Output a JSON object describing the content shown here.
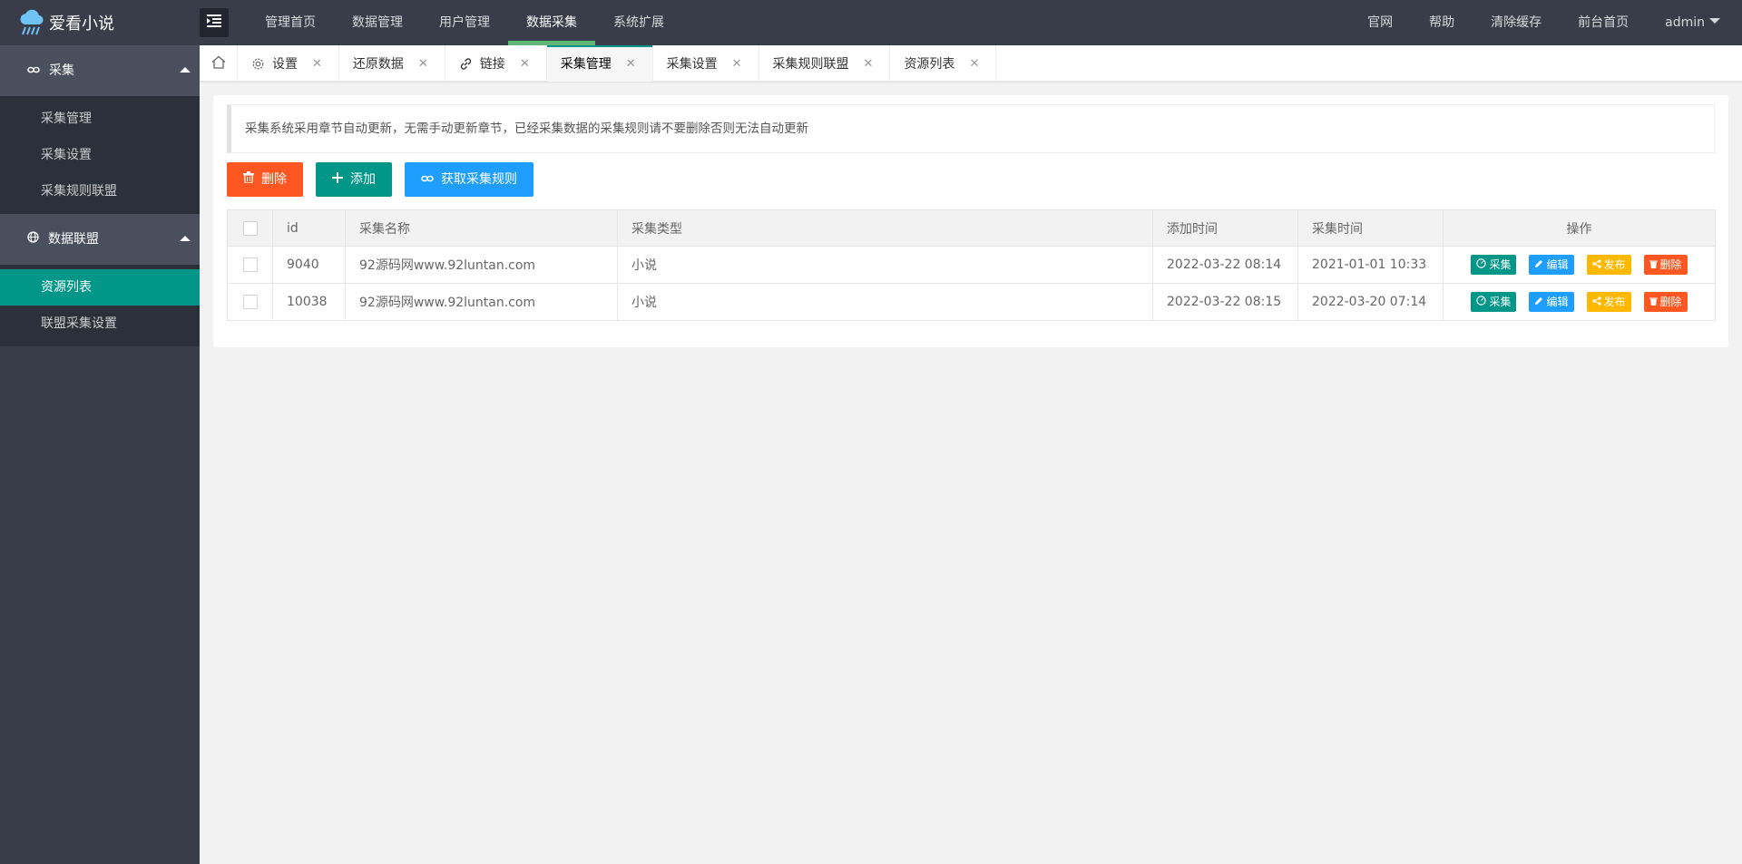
{
  "app": {
    "title": "爱看小说"
  },
  "top_nav": [
    {
      "label": "管理首页"
    },
    {
      "label": "数据管理"
    },
    {
      "label": "用户管理"
    },
    {
      "label": "数据采集",
      "active": true
    },
    {
      "label": "系统扩展"
    }
  ],
  "right_nav": [
    {
      "label": "官网"
    },
    {
      "label": "帮助"
    },
    {
      "label": "清除缓存"
    },
    {
      "label": "前台首页"
    },
    {
      "label": "admin"
    }
  ],
  "sidebar": {
    "groups": [
      {
        "title": "采集",
        "icon": "link-icon",
        "items": [
          {
            "label": "采集管理"
          },
          {
            "label": "采集设置"
          },
          {
            "label": "采集规则联盟"
          }
        ]
      },
      {
        "title": "数据联盟",
        "icon": "globe-icon",
        "items": [
          {
            "label": "资源列表",
            "active": true
          },
          {
            "label": "联盟采集设置"
          }
        ]
      }
    ]
  },
  "tabs": [
    {
      "label": "设置",
      "icon": "gear-icon"
    },
    {
      "label": "还原数据"
    },
    {
      "label": "链接",
      "icon": "link-icon"
    },
    {
      "label": "采集管理",
      "active": true
    },
    {
      "label": "采集设置"
    },
    {
      "label": "采集规则联盟"
    },
    {
      "label": "资源列表"
    }
  ],
  "notice": "采集系统采用章节自动更新，无需手动更新章节，已经采集数据的采集规则请不要删除否则无法自动更新",
  "toolbar": {
    "delete_label": "删除",
    "add_label": "添加",
    "fetch_rules_label": "获取采集规则"
  },
  "table": {
    "headers": [
      "id",
      "采集名称",
      "采集类型",
      "添加时间",
      "采集时间",
      "操作"
    ],
    "rows": [
      {
        "id": "9040",
        "name": "92源码网www.92luntan.com",
        "type": "小说",
        "added": "2022-03-22 08:14",
        "collected": "2021-01-01 10:33"
      },
      {
        "id": "10038",
        "name": "92源码网www.92luntan.com",
        "type": "小说",
        "added": "2022-03-22 08:15",
        "collected": "2022-03-20 07:14"
      }
    ],
    "actions": {
      "collect": "采集",
      "edit": "编辑",
      "publish": "发布",
      "delete": "删除"
    }
  },
  "colors": {
    "header_bg": "#393d49",
    "accent_green": "#009688",
    "nav_active_bar": "#5fb878",
    "danger": "#ff5722",
    "info": "#1e9fff",
    "warn": "#ffb800"
  }
}
